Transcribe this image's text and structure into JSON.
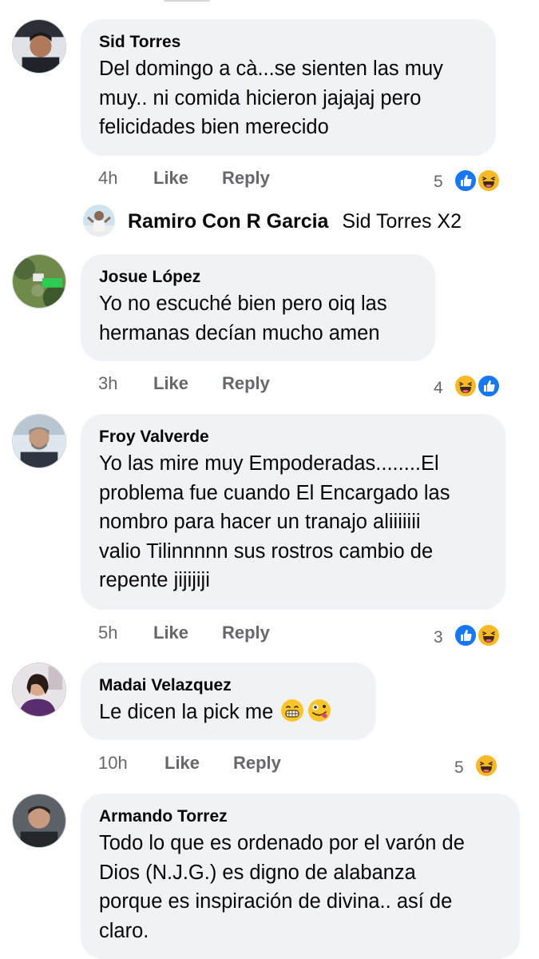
{
  "comments": [
    {
      "author": "Sid Torres",
      "lines": [
        "Del domingo a cà...se sienten las muy",
        "muy..  ni comida hicieron jajajaj pero",
        "felicidades bien merecido"
      ],
      "time": "4h",
      "like": "Like",
      "reply": "Reply",
      "reaction_count": "5",
      "reactions": [
        "like",
        "haha"
      ]
    },
    {
      "author": "Josue López",
      "lines": [
        "Yo no escuché bien pero oiq las",
        "hermanas decían mucho amen"
      ],
      "time": "3h",
      "like": "Like",
      "reply": "Reply",
      "reaction_count": "4",
      "reactions": [
        "haha",
        "like"
      ]
    },
    {
      "author": "Froy Valverde",
      "lines": [
        "Yo las mire muy Empoderadas........El",
        "problema fue cuando El Encargado las",
        "nombro para hacer un tranajo aliiiiiii",
        "valio Tilinnnnn sus rostros cambio de",
        "repente jijijiji"
      ],
      "time": "5h",
      "like": "Like",
      "reply": "Reply",
      "reaction_count": "3",
      "reactions": [
        "like",
        "haha"
      ]
    },
    {
      "author": "Madai Velazquez",
      "lines": [
        "Le dicen la pick me"
      ],
      "emojis": [
        "grin",
        "zany"
      ],
      "time": "10h",
      "like": "Like",
      "reply": "Reply",
      "reaction_count": "5",
      "reactions": [
        "haha"
      ]
    },
    {
      "author": "Armando Torrez",
      "lines": [
        "Todo lo que es ordenado por el varón de",
        "Dios (N.J.G.) es digno de alabanza",
        "porque es inspiración de divina.. así de",
        "claro."
      ]
    }
  ],
  "reply_preview": {
    "author": "Ramiro Con R Garcia",
    "text": "Sid Torres X2"
  },
  "colors": {
    "bubble": "#f0f2f5",
    "meta": "#65676b",
    "like_blue": "#1877f2",
    "haha_yellow": "#f7b928"
  }
}
